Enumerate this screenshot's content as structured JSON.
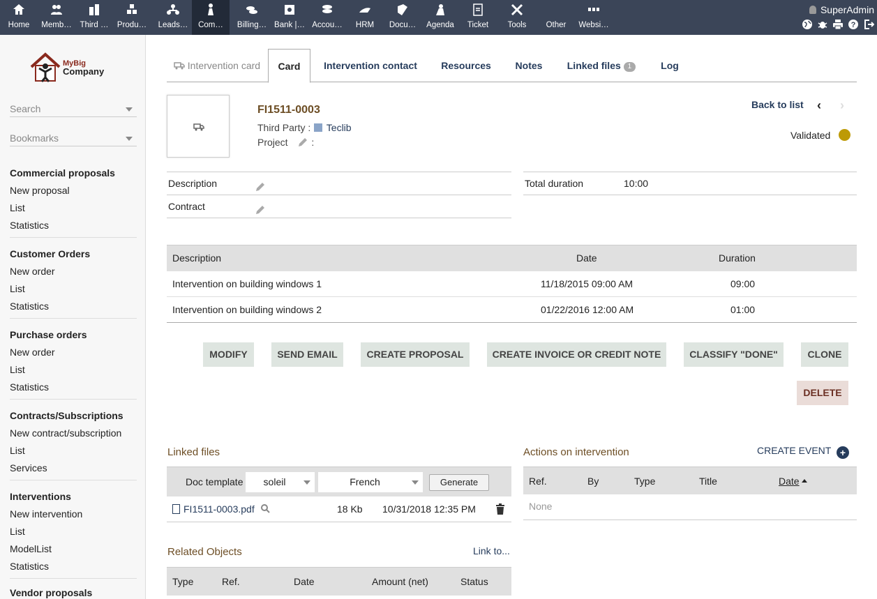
{
  "topmenu": [
    {
      "label": "Home",
      "icon": "home-icon"
    },
    {
      "label": "Memb…",
      "icon": "members-icon"
    },
    {
      "label": "Third …",
      "icon": "thirdparty-icon"
    },
    {
      "label": "Produ…",
      "icon": "products-icon"
    },
    {
      "label": "Leads…",
      "icon": "leads-icon"
    },
    {
      "label": "Com…",
      "icon": "commercial-icon"
    },
    {
      "label": "Billing…",
      "icon": "billing-icon"
    },
    {
      "label": "Bank |…",
      "icon": "bank-icon"
    },
    {
      "label": "Accou…",
      "icon": "accounting-icon"
    },
    {
      "label": "HRM",
      "icon": "hrm-icon"
    },
    {
      "label": "Docu…",
      "icon": "documents-icon"
    },
    {
      "label": "Agenda",
      "icon": "agenda-icon"
    },
    {
      "label": "Ticket",
      "icon": "ticket-icon"
    },
    {
      "label": "Tools",
      "icon": "tools-icon"
    },
    {
      "label": "Other",
      "icon": "other-icon"
    },
    {
      "label": "Websi…",
      "icon": "website-icon"
    }
  ],
  "user": "SuperAdmin",
  "logo": {
    "line1": "MyBig",
    "line2": "Company"
  },
  "sidebar": {
    "search": "Search",
    "bookmarks": "Bookmarks",
    "sections": [
      {
        "title": "Commercial proposals",
        "items": [
          "New proposal",
          "List",
          "Statistics"
        ]
      },
      {
        "title": "Customer Orders",
        "items": [
          "New order",
          "List",
          "Statistics"
        ]
      },
      {
        "title": "Purchase orders",
        "items": [
          "New order",
          "List",
          "Statistics"
        ]
      },
      {
        "title": "Contracts/Subscriptions",
        "items": [
          "New contract/subscription",
          "List",
          "Services"
        ]
      },
      {
        "title": "Interventions",
        "items": [
          "New intervention",
          "List",
          "ModelList",
          "Statistics"
        ]
      },
      {
        "title": "Vendor proposals",
        "items": []
      }
    ]
  },
  "tabs": {
    "intervention_card": "Intervention card",
    "card": "Card",
    "contact": "Intervention contact",
    "resources": "Resources",
    "notes": "Notes",
    "linked_files": "Linked files",
    "linked_count": "1",
    "log": "Log"
  },
  "header": {
    "ref": "FI1511-0003",
    "third_party_label": "Third Party :",
    "third_party": "Teclib",
    "project_label": "Project",
    "project_sep": ":",
    "back": "Back to list",
    "status": "Validated"
  },
  "fields": {
    "description": "Description",
    "contract": "Contract",
    "total_duration_label": "Total duration",
    "total_duration": "10:00"
  },
  "lines": {
    "headers": [
      "Description",
      "Date",
      "Duration"
    ],
    "rows": [
      {
        "desc": "Intervention on building windows 1",
        "date": "11/18/2015 09:00 AM",
        "duration": "09:00"
      },
      {
        "desc": "Intervention on building windows 2",
        "date": "01/22/2016 12:00 AM",
        "duration": "01:00"
      }
    ]
  },
  "buttons": {
    "modify": "MODIFY",
    "send_email": "SEND EMAIL",
    "create_proposal": "CREATE PROPOSAL",
    "create_invoice": "CREATE INVOICE OR CREDIT NOTE",
    "classify": "CLASSIFY \"DONE\"",
    "clone": "CLONE",
    "delete": "DELETE"
  },
  "linked": {
    "title": "Linked files",
    "doc_template": "Doc template",
    "template": "soleil",
    "lang": "French",
    "generate": "Generate",
    "file": "FI1511-0003.pdf",
    "size": "18 Kb",
    "date": "10/31/2018 12:35 PM"
  },
  "related": {
    "title": "Related Objects",
    "link": "Link to...",
    "headers": [
      "Type",
      "Ref.",
      "Date",
      "Amount (net)",
      "Status"
    ]
  },
  "actions": {
    "title": "Actions on intervention",
    "create_event": "CREATE EVENT",
    "headers": [
      "Ref.",
      "By",
      "Type",
      "Title",
      "Date"
    ],
    "empty": "None"
  },
  "colors": {
    "topbar": "#3b4558",
    "status_dot": "#bd9a06",
    "link": "#263c5c"
  }
}
